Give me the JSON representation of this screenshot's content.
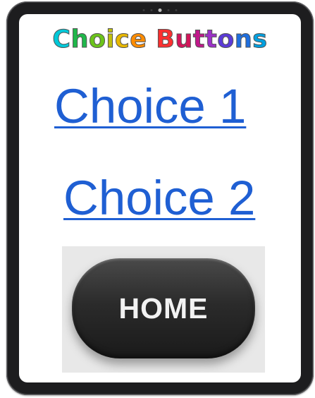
{
  "title": {
    "text": "Choice Buttons",
    "letter_colors": [
      "#00c8d8",
      "#1fb84a",
      "#6bc41a",
      "#c0c010",
      "#e8b800",
      "#ff8c00",
      "#ff3030",
      "#d4145a",
      "#c0188a",
      "#9b30c8",
      "#5b3ad8",
      "#1e6fe0",
      "#00a0e0",
      "#9b30ff"
    ]
  },
  "choices": [
    {
      "label": "Choice 1"
    },
    {
      "label": "Choice 2"
    }
  ],
  "home_button": {
    "label": "HOME"
  },
  "colors": {
    "link": "#1f5fd3",
    "frame": "#1d1d1f",
    "button": "#2b2b2b"
  }
}
